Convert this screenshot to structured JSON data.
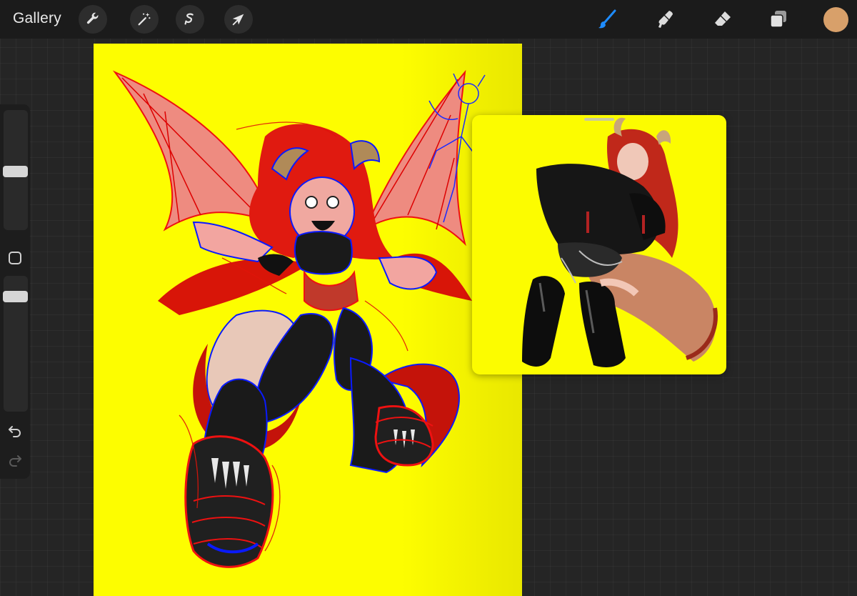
{
  "app": {
    "gallery_label": "Gallery"
  },
  "toolbar": {
    "left_tools": [
      "actions-wrench",
      "adjustments-wand",
      "selection",
      "transform-arrow"
    ],
    "right_tools": [
      "brush",
      "smudge",
      "eraser",
      "layers",
      "color"
    ],
    "active_tool": "brush",
    "accent_color": "#1e8cff",
    "current_color": "#d8a06a"
  },
  "sidebar": {
    "brush_size": 0.49,
    "opacity": 0.88
  },
  "canvas": {
    "background_color": "#fdfd00"
  },
  "reference": {
    "background_color": "#fcfc00"
  }
}
